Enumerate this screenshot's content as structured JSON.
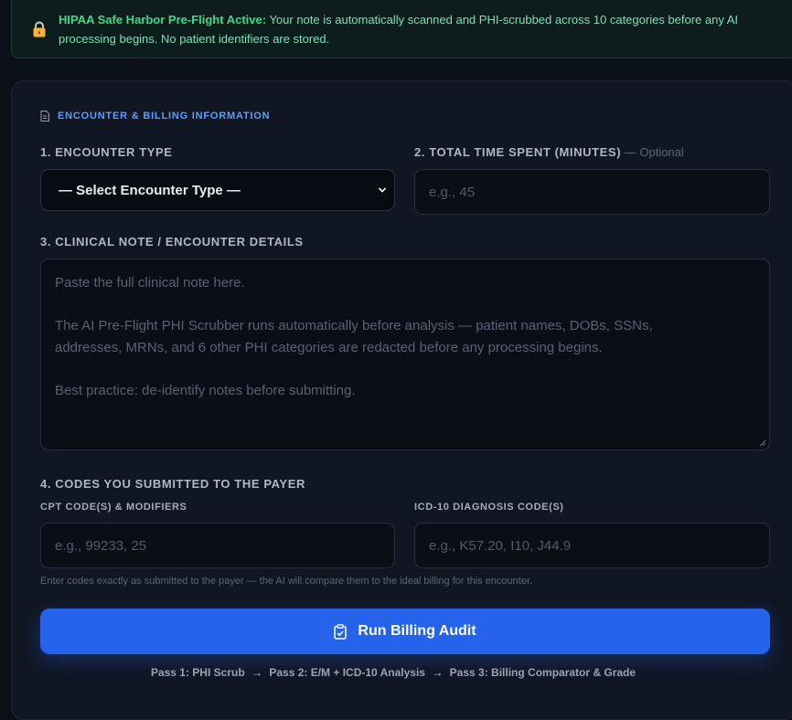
{
  "banner": {
    "title": "HIPAA Safe Harbor Pre-Flight Active:",
    "text": " Your note is automatically scanned and PHI-scrubbed across 10 categories before any AI processing begins. No patient identifiers are stored.",
    "icon": "lock-icon"
  },
  "section": {
    "title": "ENCOUNTER & BILLING INFORMATION",
    "icon": "document-icon"
  },
  "encounter_type": {
    "label": "1. ENCOUNTER TYPE",
    "selected": "— Select Encounter Type —"
  },
  "total_time": {
    "label": "2. TOTAL TIME SPENT (MINUTES)",
    "optional": " — Optional",
    "placeholder": "e.g., 45"
  },
  "clinical_note": {
    "label": "3. CLINICAL NOTE / ENCOUNTER DETAILS",
    "placeholder_lines": [
      "Paste the full clinical note here.",
      "",
      "The AI Pre-Flight PHI Scrubber runs automatically before analysis — patient names, DOBs, SSNs,",
      "addresses, MRNs, and 6 other PHI categories are redacted before any processing begins.",
      "",
      "Best practice: de-identify notes before submitting."
    ]
  },
  "codes": {
    "label": "4. CODES YOU SUBMITTED TO THE PAYER",
    "cpt_label": "CPT CODE(S) & MODIFIERS",
    "cpt_placeholder": "e.g., 99233, 25",
    "icd_label": "ICD-10 DIAGNOSIS CODE(S)",
    "icd_placeholder": "e.g., K57.20, I10, J44.9",
    "hint": "Enter codes exactly as submitted to the payer — the AI will compare them to the ideal billing for this encounter."
  },
  "run_button": {
    "label": "Run Billing Audit",
    "icon": "clipboard-check-icon"
  },
  "passes": {
    "items": [
      "Pass 1: PHI Scrub",
      "Pass 2: E/M + ICD-10 Analysis",
      "Pass 3: Billing Comparator & Grade"
    ],
    "arrow": "→"
  },
  "colors": {
    "accent": "#2563eb",
    "banner_title": "#3fd98e",
    "section_title": "#5b9dff",
    "background": "#0b0f18",
    "card": "#111623"
  }
}
